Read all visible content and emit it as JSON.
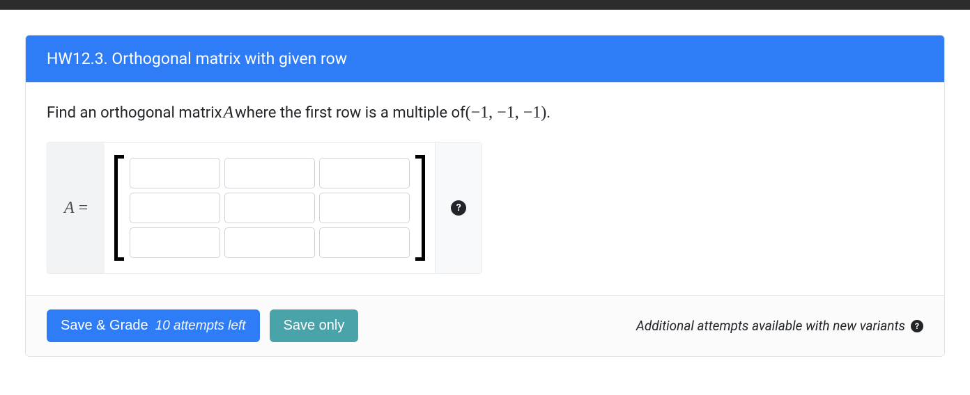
{
  "header": {
    "title": "HW12.3. Orthogonal matrix with given row"
  },
  "prompt": {
    "lead": "Find an orthogonal matrix ",
    "matrix_var": "A",
    "mid": " where the first row is a multiple of ",
    "vector": "(−1, −1, −1)",
    "tail": "."
  },
  "answer": {
    "label_var": "A",
    "label_eq": "=",
    "rows": 3,
    "cols": 3,
    "cells": [
      "",
      "",
      "",
      "",
      "",
      "",
      "",
      "",
      ""
    ]
  },
  "footer": {
    "save_grade_label": "Save & Grade",
    "attempts_text": "10 attempts left",
    "save_only_label": "Save only",
    "additional_text": "Additional attempts available with new variants"
  },
  "icons": {
    "help_glyph": "?"
  }
}
